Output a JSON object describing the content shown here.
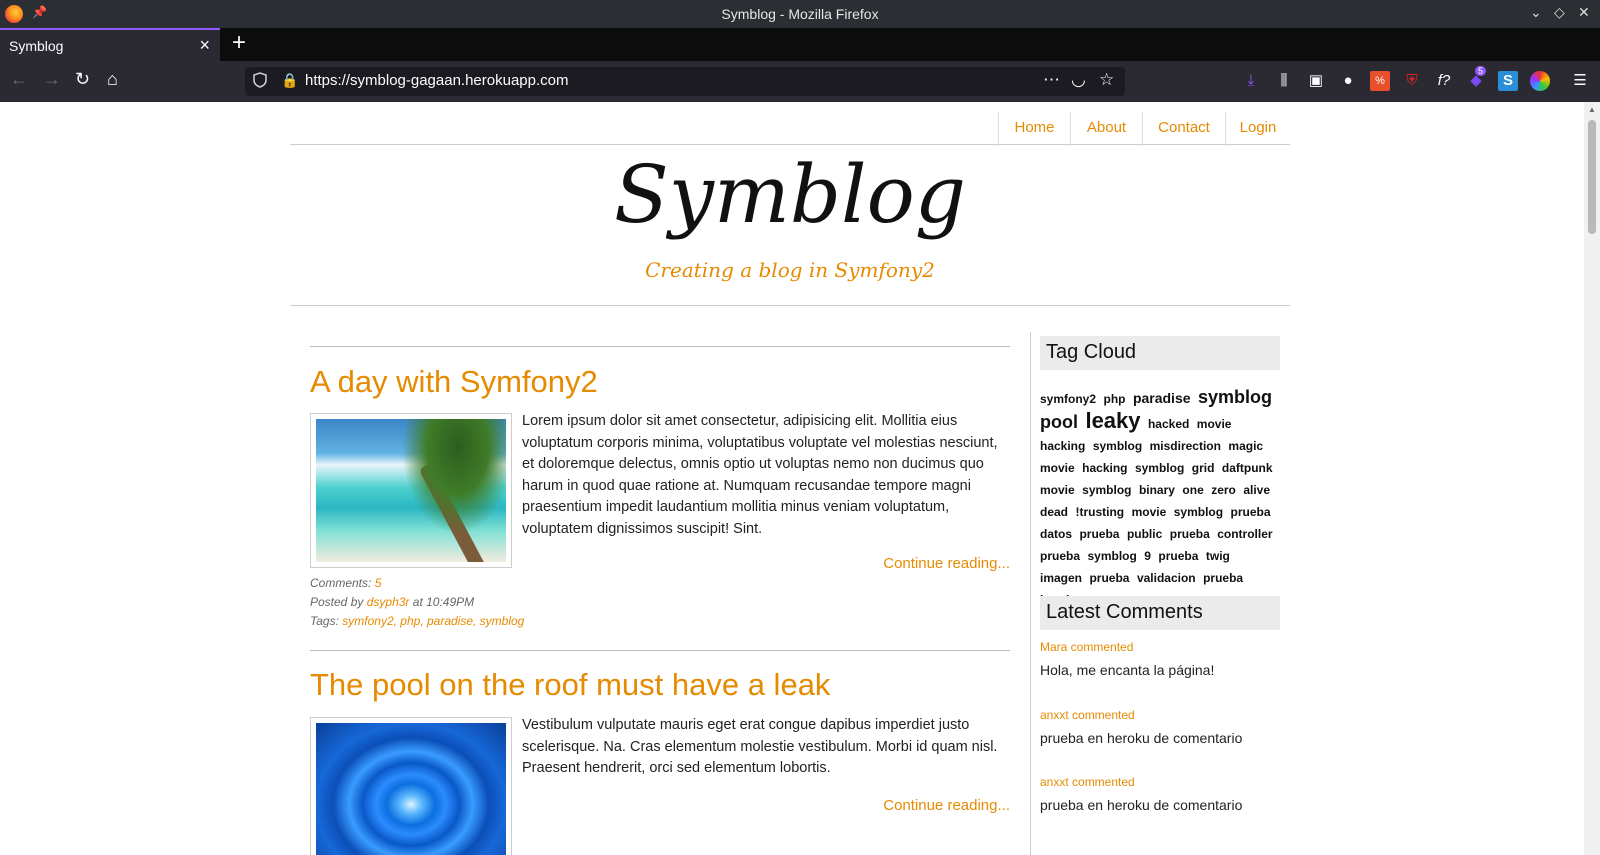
{
  "window": {
    "title": "Symblog - Mozilla Firefox"
  },
  "tab": {
    "title": "Symblog"
  },
  "address": {
    "url": "https://symblog-gagaan.herokuapp.com"
  },
  "toolbar": {
    "ext_badge": "5",
    "fx_label": "f?"
  },
  "site": {
    "menu": [
      "Home",
      "About",
      "Contact",
      "Login"
    ],
    "logo": "Symblog",
    "tagline": "Creating a blog in Symfony2"
  },
  "posts": [
    {
      "title": "A day with Symfony2",
      "image": "beach-palm-photo",
      "body": "Lorem ipsum dolor sit amet consectetur, adipisicing elit. Mollitia eius voluptatum corporis minima, voluptatibus voluptate vel molestias nesciunt, et doloremque delectus, omnis optio ut voluptas nemo non ducimus quo harum in quod quae ratione at. Numquam recusandae tempore magni praesentium impedit laudantium mollitia minus veniam voluptatum, voluptatem dignissimos suscipit! Sint.",
      "continue": "Continue reading...",
      "comments_label": "Comments:",
      "comments_count": "5",
      "posted_by_label": "Posted by",
      "author": "dsyph3r",
      "at_label": "at",
      "time": "10:49PM",
      "tags_label": "Tags:",
      "tags": "symfony2, php, paradise, symblog"
    },
    {
      "title": "The pool on the roof must have a leak",
      "image": "water-drop-photo",
      "body": "Vestibulum vulputate mauris eget erat congue dapibus imperdiet justo scelerisque. Na. Cras elementum molestie vestibulum. Morbi id quam nisl. Praesent hendrerit, orci sed elementum lobortis.",
      "continue": "Continue reading..."
    }
  ],
  "sidebar": {
    "tag_cloud_title": "Tag Cloud",
    "tags": [
      {
        "t": "symfony2",
        "w": 1
      },
      {
        "t": "php",
        "w": 1
      },
      {
        "t": "paradise",
        "w": 2
      },
      {
        "t": "symblog",
        "w": 3
      },
      {
        "t": "pool",
        "w": 3
      },
      {
        "t": "leaky",
        "w": 4
      },
      {
        "t": "hacked",
        "w": 1
      },
      {
        "t": "movie",
        "w": 1
      },
      {
        "t": "hacking",
        "w": 1
      },
      {
        "t": "symblog",
        "w": 1
      },
      {
        "t": "misdirection",
        "w": 1
      },
      {
        "t": "magic",
        "w": 1
      },
      {
        "t": "movie",
        "w": 1
      },
      {
        "t": "hacking",
        "w": 1
      },
      {
        "t": "symblog",
        "w": 1
      },
      {
        "t": "grid",
        "w": 1
      },
      {
        "t": "daftpunk",
        "w": 1
      },
      {
        "t": "movie",
        "w": 1
      },
      {
        "t": "symblog",
        "w": 1
      },
      {
        "t": "binary",
        "w": 1
      },
      {
        "t": "one",
        "w": 1
      },
      {
        "t": "zero",
        "w": 1
      },
      {
        "t": "alive",
        "w": 1
      },
      {
        "t": "dead",
        "w": 1
      },
      {
        "t": "!trusting",
        "w": 1
      },
      {
        "t": "movie",
        "w": 1
      },
      {
        "t": "symblog",
        "w": 1
      },
      {
        "t": "prueba",
        "w": 1
      },
      {
        "t": "datos",
        "w": 1
      },
      {
        "t": "prueba",
        "w": 1
      },
      {
        "t": "public",
        "w": 1
      },
      {
        "t": "prueba",
        "w": 1
      },
      {
        "t": "controller",
        "w": 1
      },
      {
        "t": "prueba",
        "w": 1
      },
      {
        "t": "symblog",
        "w": 1
      },
      {
        "t": "9",
        "w": 1
      },
      {
        "t": "prueba",
        "w": 1
      },
      {
        "t": "twig",
        "w": 1
      },
      {
        "t": "imagen",
        "w": 1
      },
      {
        "t": "prueba",
        "w": 1
      },
      {
        "t": "validacion",
        "w": 1
      },
      {
        "t": "prueba",
        "w": 1
      },
      {
        "t": "heroku",
        "w": 1
      }
    ],
    "latest_title": "Latest Comments",
    "comments": [
      {
        "author": "Mara commented",
        "text": "Hola, me encanta la página!"
      },
      {
        "author": "anxxt commented",
        "text": "prueba en heroku de comentario"
      },
      {
        "author": "anxxt commented",
        "text": "prueba en heroku de comentario"
      }
    ]
  }
}
